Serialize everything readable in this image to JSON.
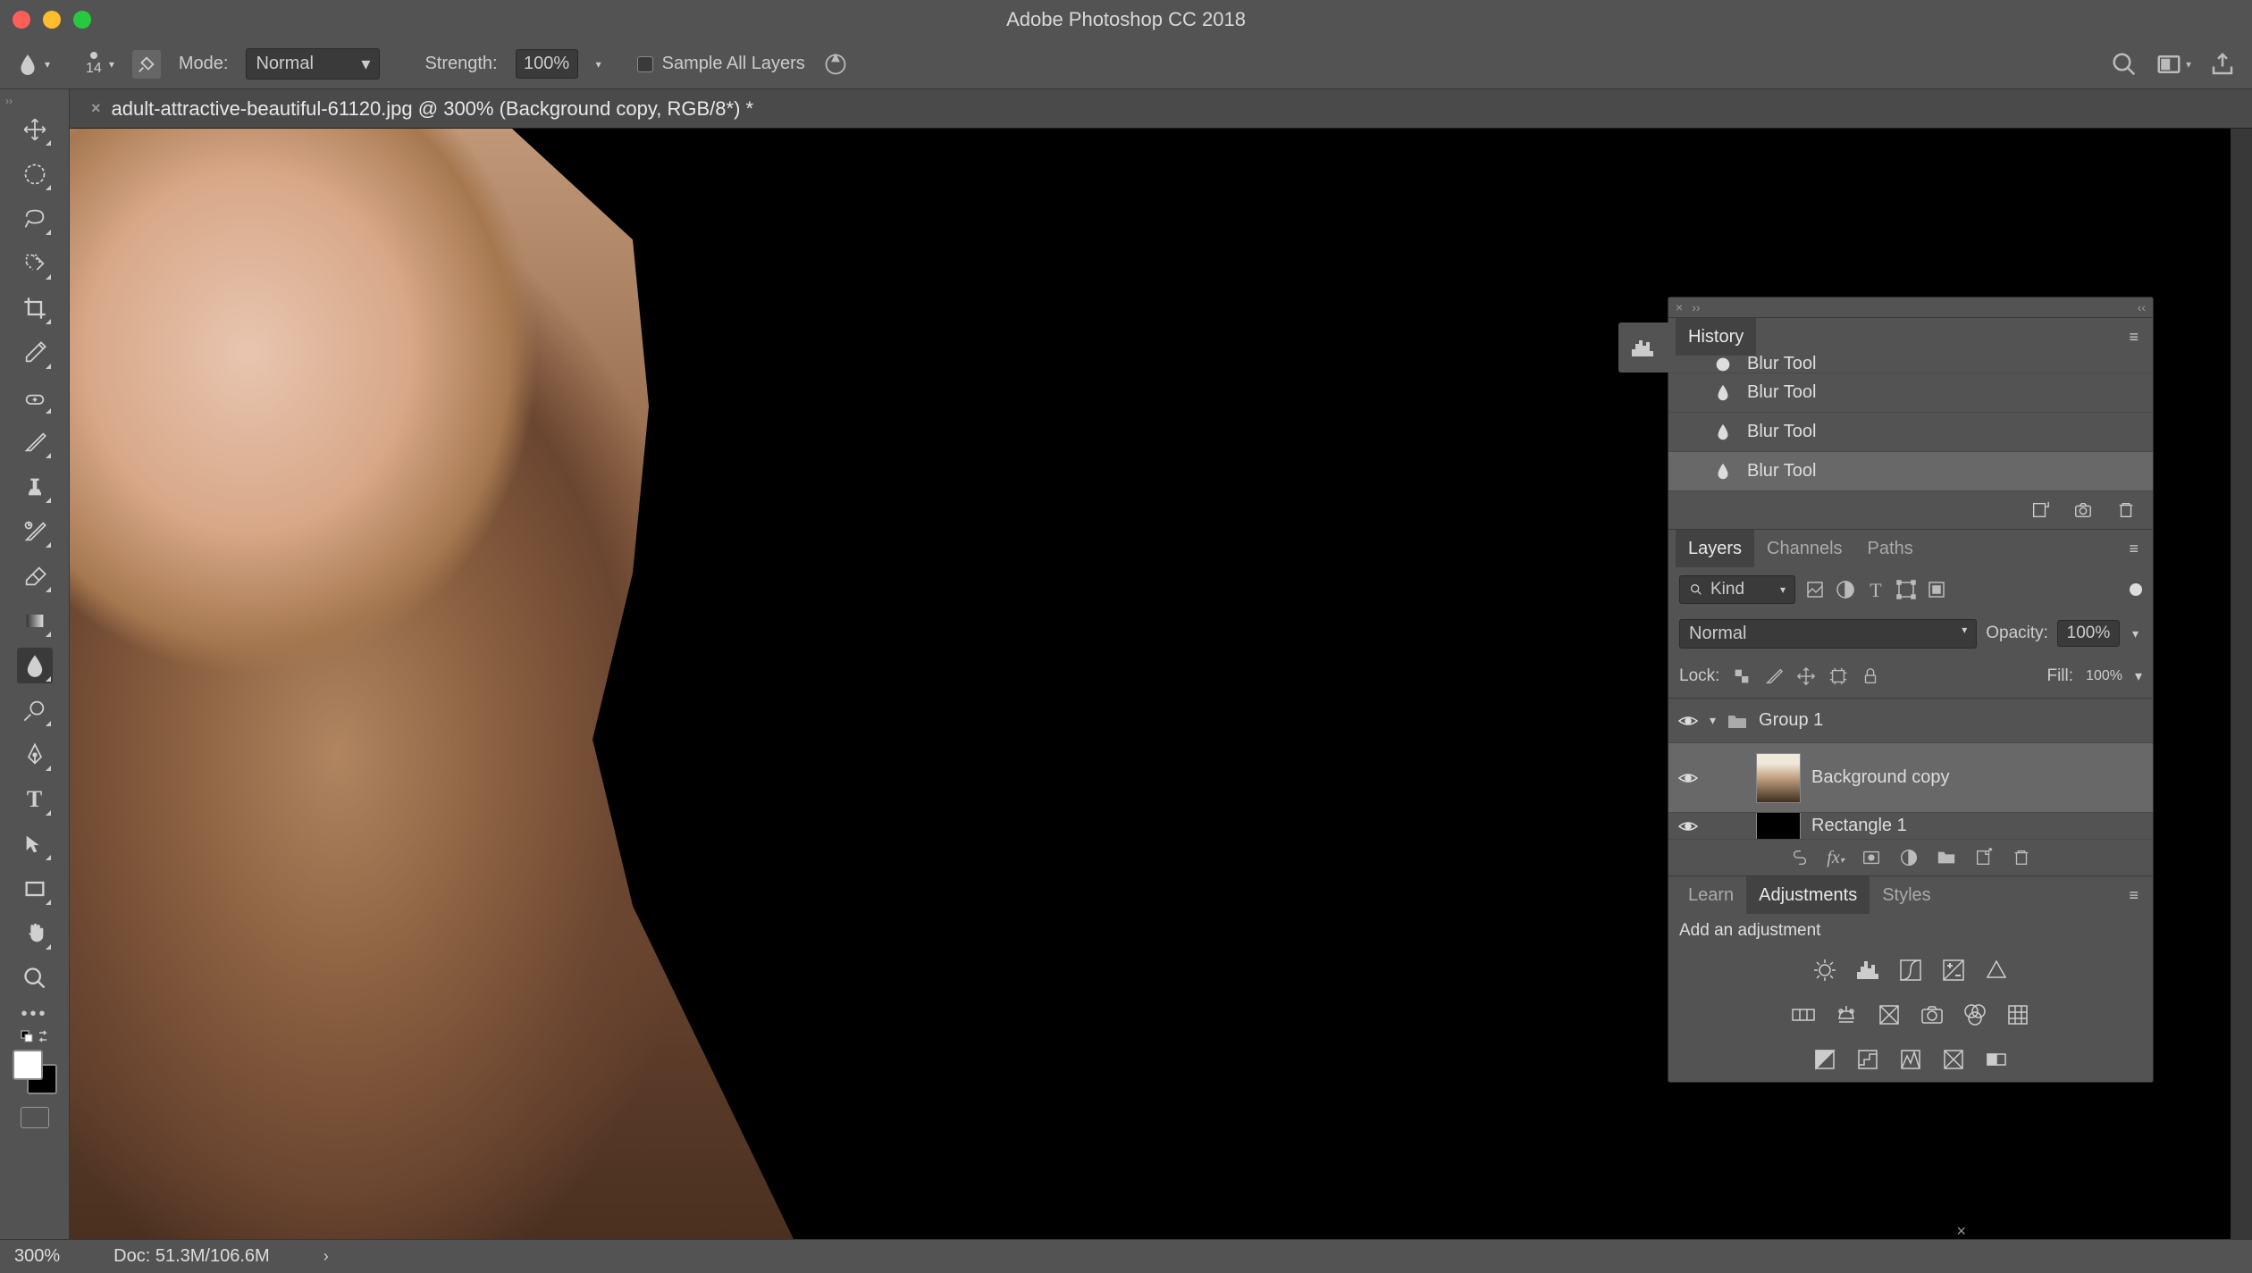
{
  "app_title": "Adobe Photoshop CC 2018",
  "options_bar": {
    "brush_size": "14",
    "mode_label": "Mode:",
    "mode_value": "Normal",
    "strength_label": "Strength:",
    "strength_value": "100%",
    "sample_all_label": "Sample All Layers"
  },
  "document_tab": {
    "title": "adult-attractive-beautiful-61120.jpg @ 300% (Background copy, RGB/8*) *"
  },
  "tools": [
    {
      "name": "move-tool",
      "flyout": true
    },
    {
      "name": "marquee-tool",
      "flyout": true
    },
    {
      "name": "lasso-tool",
      "flyout": true
    },
    {
      "name": "quick-selection-tool",
      "flyout": true
    },
    {
      "name": "crop-tool",
      "flyout": true
    },
    {
      "name": "eyedropper-tool",
      "flyout": true
    },
    {
      "name": "healing-tool",
      "flyout": true
    },
    {
      "name": "brush-tool",
      "flyout": true
    },
    {
      "name": "clone-stamp-tool",
      "flyout": true
    },
    {
      "name": "history-brush-tool",
      "flyout": true
    },
    {
      "name": "eraser-tool",
      "flyout": true
    },
    {
      "name": "gradient-tool",
      "flyout": true
    },
    {
      "name": "blur-tool",
      "active": true,
      "flyout": true
    },
    {
      "name": "dodge-tool",
      "flyout": true
    },
    {
      "name": "pen-tool",
      "flyout": true
    },
    {
      "name": "type-tool",
      "flyout": true
    },
    {
      "name": "path-selection-tool",
      "flyout": true
    },
    {
      "name": "rectangle-tool",
      "flyout": true
    },
    {
      "name": "hand-tool",
      "flyout": true
    },
    {
      "name": "zoom-tool",
      "flyout": false
    }
  ],
  "history": {
    "tab_label": "History",
    "items": [
      {
        "label": "Blur Tool",
        "icon": "blur"
      },
      {
        "label": "Blur Tool",
        "icon": "blur"
      },
      {
        "label": "Blur Tool",
        "icon": "blur"
      },
      {
        "label": "Blur Tool",
        "icon": "blur",
        "current": true
      }
    ]
  },
  "layers_panel": {
    "tabs": [
      "Layers",
      "Channels",
      "Paths"
    ],
    "active_tab": 0,
    "filter_kind": "Kind",
    "blend_mode": "Normal",
    "opacity_label": "Opacity:",
    "opacity_value": "100%",
    "lock_label": "Lock:",
    "fill_label": "Fill:",
    "fill_value": "100%",
    "layers": [
      {
        "type": "group",
        "name": "Group 1",
        "expanded": true
      },
      {
        "type": "layer",
        "name": "Background copy",
        "selected": true,
        "thumb": "person"
      },
      {
        "type": "layer",
        "name": "Rectangle 1",
        "thumb": "black",
        "partial": true
      }
    ]
  },
  "adjustments_panel": {
    "tabs": [
      "Learn",
      "Adjustments",
      "Styles"
    ],
    "active_tab": 1,
    "heading": "Add an adjustment"
  },
  "status": {
    "zoom": "300%",
    "doc_size": "Doc: 51.3M/106.6M"
  }
}
